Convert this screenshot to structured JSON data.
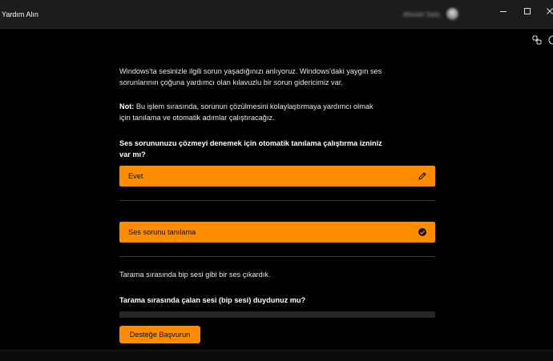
{
  "window": {
    "title": "Yardım Alın",
    "user_name": "Ahmet Sels"
  },
  "colors": {
    "accent": "#ff8c00",
    "background": "#000000",
    "titlebar": "#1c1c1c",
    "divider": "#3a3a3a"
  },
  "icons": {
    "minimize": "minimize-icon",
    "maximize": "maximize-icon",
    "close": "close-icon",
    "share": "share-link-icon",
    "help": "help-icon",
    "edit": "pencil-icon",
    "check": "check-circle-icon"
  },
  "conversation": {
    "intro": "Windows'ta sesinizle ilgili sorun yaşadığınızı anlıyoruz. Windows'daki yaygın ses sorunlarının çoğuna yardımcı olan kılavuzlu bir sorun gidericimiz var.",
    "note_label": "Not:",
    "note_text": " Bu işlem sırasında, sorunun çözülmesini kolaylaştırmaya yardımcı olmak için tanılama ve otomatik adımlar çalıştıracağız.",
    "question_1": "Ses sorununuzu çözmeyi denemek için otomatik tanılama çalıştırma izniniz var mı?",
    "answer_1": "Evet",
    "answer_2": "Ses sorunu tanılama",
    "status_text": "Tarama sırasında bip sesi gibi bir ses çıkardık.",
    "question_2": "Tarama sırasında çalan sesi (bip sesi) duydunuz mu?"
  },
  "actions": {
    "contact_support": "Desteğe Başvurun"
  }
}
